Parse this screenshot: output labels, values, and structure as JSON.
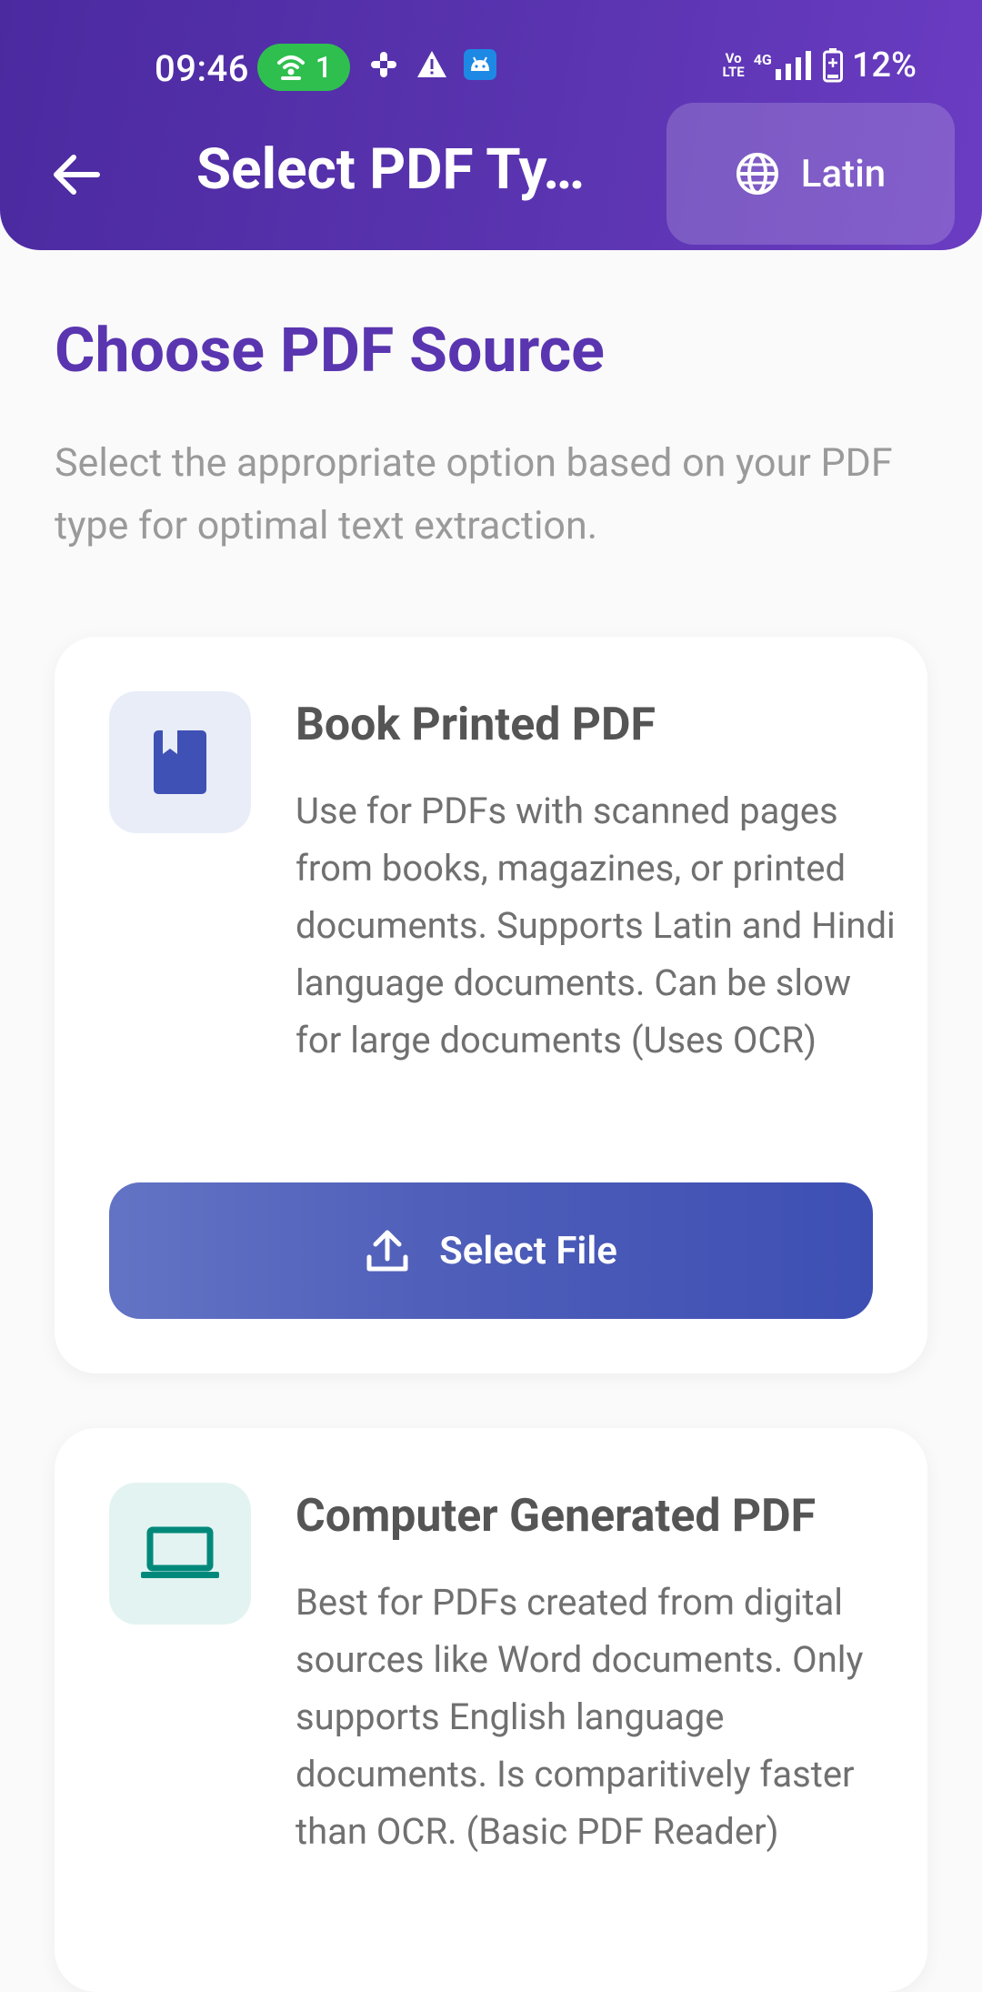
{
  "status_bar": {
    "time": "09:46",
    "hotspot_count": "1",
    "network": "4G",
    "volte_top": "Vo",
    "volte_bottom": "LTE",
    "battery": "12%"
  },
  "header": {
    "title": "Select PDF Ty…",
    "language_label": "Latin"
  },
  "main": {
    "heading": "Choose PDF Source",
    "subtitle": "Select the appropriate option based on your PDF type for optimal text extraction."
  },
  "cards": [
    {
      "title": "Book Printed PDF",
      "description": "Use for PDFs with scanned pages from books, magazines, or printed documents. Supports Latin and Hindi language documents. Can be slow for large documents (Uses OCR)",
      "button_label": "Select File",
      "icon": "book-icon"
    },
    {
      "title": "Computer Generated PDF",
      "description": "Best for PDFs created from digital sources like Word documents. Only supports English language documents. Is comparitively faster than OCR. (Basic PDF Reader)",
      "icon": "laptop-icon"
    }
  ],
  "colors": {
    "header_start": "#4b2aa0",
    "header_end": "#6a3cc2",
    "heading": "#5a35b0",
    "button": "#4c5cb8",
    "book_icon": "#3f51b5",
    "laptop_icon": "#00897b"
  }
}
